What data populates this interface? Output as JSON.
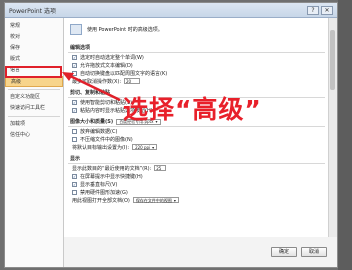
{
  "window": {
    "title": "PowerPoint 选项",
    "help": "?",
    "close": "✕"
  },
  "sidebar": {
    "items": [
      {
        "label": "常规"
      },
      {
        "label": "校对"
      },
      {
        "label": "保存"
      },
      {
        "label": "版式"
      },
      {
        "label": "语言"
      },
      {
        "label": "高级"
      },
      {
        "label": "自定义功能区"
      },
      {
        "label": "快速访问工具栏"
      },
      {
        "label": "加载项"
      },
      {
        "label": "信任中心"
      }
    ]
  },
  "header": {
    "text": "使用 PowerPoint 时的高级选项。"
  },
  "sections": {
    "editing": {
      "title": "编辑选项",
      "opt1": "选定时自动选定整个单词(W)",
      "opt2": "允许拖放式文本编辑(D)",
      "opt3": "自动切换键盘以匹配周围文字的语言(K)",
      "undo_label": "最多可取消操作数(X):",
      "undo_value": "20"
    },
    "cutpaste": {
      "title": "剪切、复制和粘贴",
      "opt1": "使用智能剪切和粘贴(S)",
      "opt2": "粘贴内容时显示粘贴选项按钮(H)"
    },
    "image": {
      "title": "图像大小和质量(S)",
      "file": "百度经验专用.pptx",
      "opt1": "放弃编辑数据(C)",
      "opt2": "不压缩文件中的图像(N)",
      "res_label": "将默认目标输出设置为(I):",
      "res_value": "220 ppi"
    },
    "display": {
      "title": "显示",
      "recent_label": "显示此数目的“最近使用的文档”(R):",
      "recent_value": "25",
      "opt1": "在屏幕提示中显示快捷键(H)",
      "opt2": "显示垂直标尺(V)",
      "opt3": "禁用硬件图形加速(G)",
      "view_label": "用此视图打开全部文档(O)",
      "view_value": "保存在文件中的视图"
    }
  },
  "footer": {
    "ok": "确定",
    "cancel": "取消"
  },
  "annotation": {
    "text": "选择“高级”"
  },
  "colors": {
    "annotation": "#e8202a",
    "active_item": "#f7d48b"
  }
}
